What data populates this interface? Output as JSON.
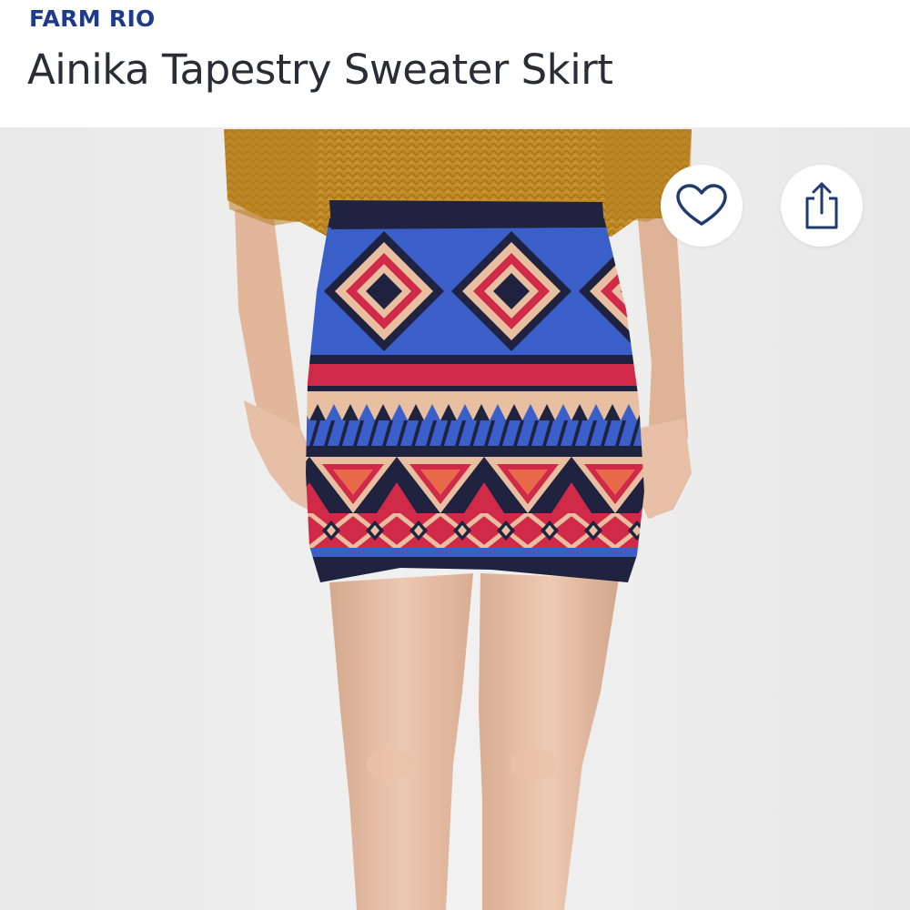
{
  "listing": {
    "brand": "FARM RIO",
    "title": "Ainika Tapestry Sweater Skirt"
  },
  "actions": {
    "like_icon": "heart-outline-icon",
    "share_icon": "share-upload-icon"
  },
  "colors": {
    "brand_text": "#1e3a8a",
    "title_text": "#2b2d36",
    "icon_stroke": "#1e3a6e",
    "background": "#ececec",
    "sweater": "#c08a26",
    "skirt_navy": "#1f2340",
    "skirt_red": "#d12a48",
    "skirt_blue": "#3a5fc8",
    "skirt_beige": "#e8bfa0",
    "skin": "#e6bfa6"
  }
}
